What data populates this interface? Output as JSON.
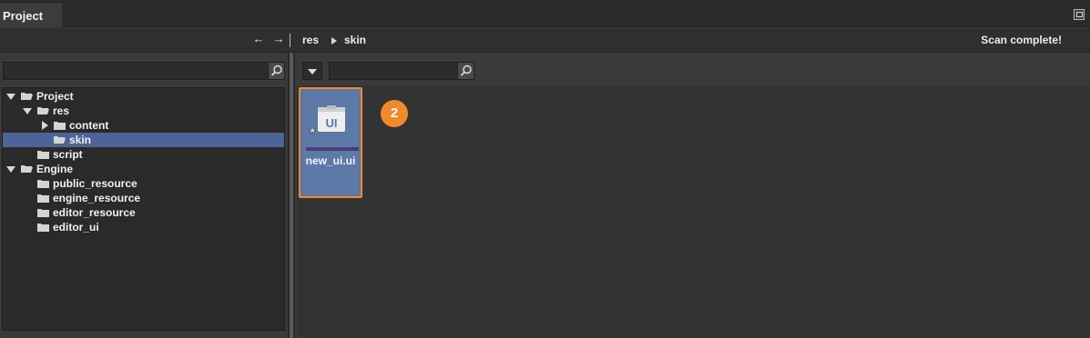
{
  "panel": {
    "tab_label": "Project"
  },
  "nav": {
    "breadcrumb": [
      "res",
      "skin"
    ],
    "status": "Scan complete!"
  },
  "left_search": {
    "placeholder": ""
  },
  "tree": [
    {
      "label": "Project",
      "expanded": true,
      "selected": false
    },
    {
      "label": "res",
      "expanded": true,
      "selected": false
    },
    {
      "label": "content",
      "expanded": false,
      "selected": false
    },
    {
      "label": "skin",
      "selected": true
    },
    {
      "label": "script",
      "selected": false
    },
    {
      "label": "Engine",
      "expanded": true,
      "selected": false
    },
    {
      "label": "public_resource",
      "selected": false
    },
    {
      "label": "engine_resource",
      "selected": false
    },
    {
      "label": "editor_resource",
      "selected": false
    },
    {
      "label": "editor_ui",
      "selected": false
    }
  ],
  "right_search": {
    "placeholder": ""
  },
  "assets": [
    {
      "name": "new_ui.ui",
      "icon_text": "UI",
      "badge": "*"
    }
  ],
  "annotation": {
    "step": "2"
  },
  "colors": {
    "selection": "#4d6496",
    "highlight": "#f08a2a",
    "asset_bg": "#5876a6"
  }
}
